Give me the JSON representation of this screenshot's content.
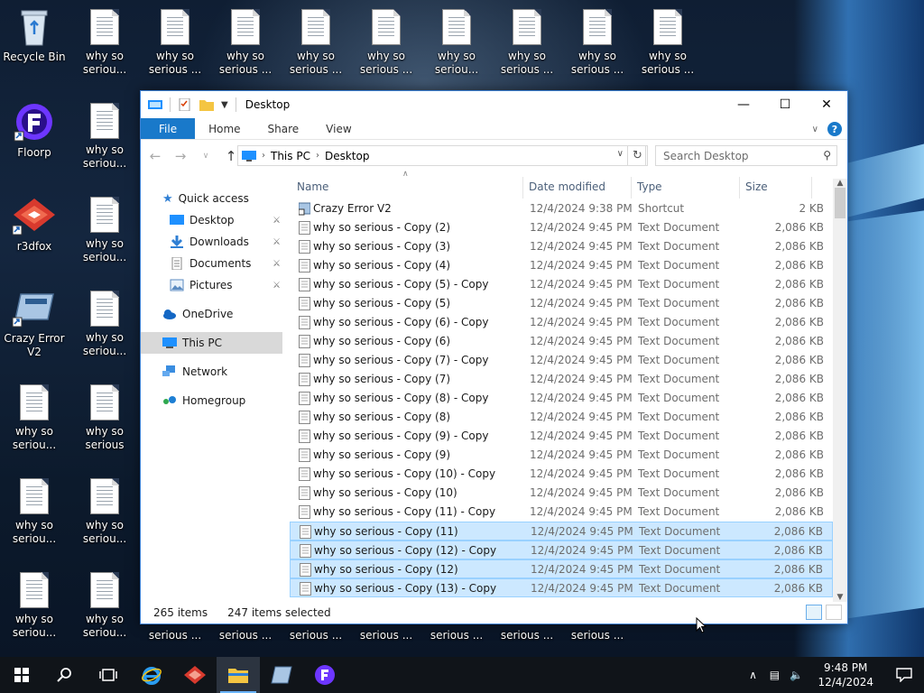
{
  "desktop": {
    "icons": [
      {
        "label": "Recycle Bin"
      },
      {
        "label": "Floorp"
      },
      {
        "label": "r3dfox"
      },
      {
        "label": "Crazy Error V2"
      },
      {
        "label": "why so seriou..."
      },
      {
        "label": "why so seriou..."
      },
      {
        "label": "why so seriou..."
      },
      {
        "label": "why so seriou..."
      },
      {
        "label": "why so seriou..."
      },
      {
        "label": "why so seriou..."
      },
      {
        "label": "why so seriou..."
      },
      {
        "label": "why so seriou..."
      },
      {
        "label": "why so serious"
      },
      {
        "label": "why so seriou..."
      },
      {
        "label": "why so seriou..."
      },
      {
        "label": "why so serious ..."
      },
      {
        "label": "why so serious ..."
      },
      {
        "label": "why so serious ..."
      },
      {
        "label": "why so serious ..."
      },
      {
        "label": "why so seriou..."
      },
      {
        "label": "why so serious ..."
      },
      {
        "label": "why so serious ..."
      },
      {
        "label": "why so serious ..."
      }
    ],
    "bottom_labels": [
      "serious ...",
      "serious ...",
      "serious ...",
      "serious ...",
      "serious ...",
      "serious ...",
      "serious ..."
    ]
  },
  "window": {
    "title": "Desktop",
    "ribbon_tabs": [
      "File",
      "Home",
      "Share",
      "View"
    ],
    "address": {
      "root": "This PC",
      "current": "Desktop"
    },
    "search_placeholder": "Search Desktop",
    "nav_pane": {
      "quick_access": "Quick access",
      "quick_items": [
        "Desktop",
        "Downloads",
        "Documents",
        "Pictures"
      ],
      "onedrive": "OneDrive",
      "this_pc": "This PC",
      "network": "Network",
      "homegroup": "Homegroup"
    },
    "columns": {
      "name": "Name",
      "date": "Date modified",
      "type": "Type",
      "size": "Size"
    },
    "files": [
      {
        "name": "Crazy Error V2",
        "date": "12/4/2024 9:38 PM",
        "type": "Shortcut",
        "size": "2 KB",
        "selected": false
      },
      {
        "name": "why so serious - Copy (2)",
        "date": "12/4/2024 9:45 PM",
        "type": "Text Document",
        "size": "2,086 KB",
        "selected": false
      },
      {
        "name": "why so serious - Copy (3)",
        "date": "12/4/2024 9:45 PM",
        "type": "Text Document",
        "size": "2,086 KB",
        "selected": false
      },
      {
        "name": "why so serious - Copy (4)",
        "date": "12/4/2024 9:45 PM",
        "type": "Text Document",
        "size": "2,086 KB",
        "selected": false
      },
      {
        "name": "why so serious - Copy (5) - Copy",
        "date": "12/4/2024 9:45 PM",
        "type": "Text Document",
        "size": "2,086 KB",
        "selected": false
      },
      {
        "name": "why so serious - Copy (5)",
        "date": "12/4/2024 9:45 PM",
        "type": "Text Document",
        "size": "2,086 KB",
        "selected": false
      },
      {
        "name": "why so serious - Copy (6) - Copy",
        "date": "12/4/2024 9:45 PM",
        "type": "Text Document",
        "size": "2,086 KB",
        "selected": false
      },
      {
        "name": "why so serious - Copy (6)",
        "date": "12/4/2024 9:45 PM",
        "type": "Text Document",
        "size": "2,086 KB",
        "selected": false
      },
      {
        "name": "why so serious - Copy (7) - Copy",
        "date": "12/4/2024 9:45 PM",
        "type": "Text Document",
        "size": "2,086 KB",
        "selected": false
      },
      {
        "name": "why so serious - Copy (7)",
        "date": "12/4/2024 9:45 PM",
        "type": "Text Document",
        "size": "2,086 KB",
        "selected": false
      },
      {
        "name": "why so serious - Copy (8) - Copy",
        "date": "12/4/2024 9:45 PM",
        "type": "Text Document",
        "size": "2,086 KB",
        "selected": false
      },
      {
        "name": "why so serious - Copy (8)",
        "date": "12/4/2024 9:45 PM",
        "type": "Text Document",
        "size": "2,086 KB",
        "selected": false
      },
      {
        "name": "why so serious - Copy (9) - Copy",
        "date": "12/4/2024 9:45 PM",
        "type": "Text Document",
        "size": "2,086 KB",
        "selected": false
      },
      {
        "name": "why so serious - Copy (9)",
        "date": "12/4/2024 9:45 PM",
        "type": "Text Document",
        "size": "2,086 KB",
        "selected": false
      },
      {
        "name": "why so serious - Copy (10) - Copy",
        "date": "12/4/2024 9:45 PM",
        "type": "Text Document",
        "size": "2,086 KB",
        "selected": false
      },
      {
        "name": "why so serious - Copy (10)",
        "date": "12/4/2024 9:45 PM",
        "type": "Text Document",
        "size": "2,086 KB",
        "selected": false
      },
      {
        "name": "why so serious - Copy (11) - Copy",
        "date": "12/4/2024 9:45 PM",
        "type": "Text Document",
        "size": "2,086 KB",
        "selected": false
      },
      {
        "name": "why so serious - Copy (11)",
        "date": "12/4/2024 9:45 PM",
        "type": "Text Document",
        "size": "2,086 KB",
        "selected": true
      },
      {
        "name": "why so serious - Copy (12) - Copy",
        "date": "12/4/2024 9:45 PM",
        "type": "Text Document",
        "size": "2,086 KB",
        "selected": true
      },
      {
        "name": "why so serious - Copy (12)",
        "date": "12/4/2024 9:45 PM",
        "type": "Text Document",
        "size": "2,086 KB",
        "selected": true
      },
      {
        "name": "why so serious - Copy (13) - Copy",
        "date": "12/4/2024 9:45 PM",
        "type": "Text Document",
        "size": "2,086 KB",
        "selected": true
      }
    ],
    "status": {
      "item_count": "265 items",
      "selected_count": "247 items selected"
    }
  },
  "taskbar": {
    "time": "9:48 PM",
    "date": "12/4/2024"
  },
  "colors": {
    "accent": "#1979ca",
    "selection_bg": "#cce8ff",
    "selection_border": "#99d1ff",
    "taskbar_bg": "#101419"
  }
}
